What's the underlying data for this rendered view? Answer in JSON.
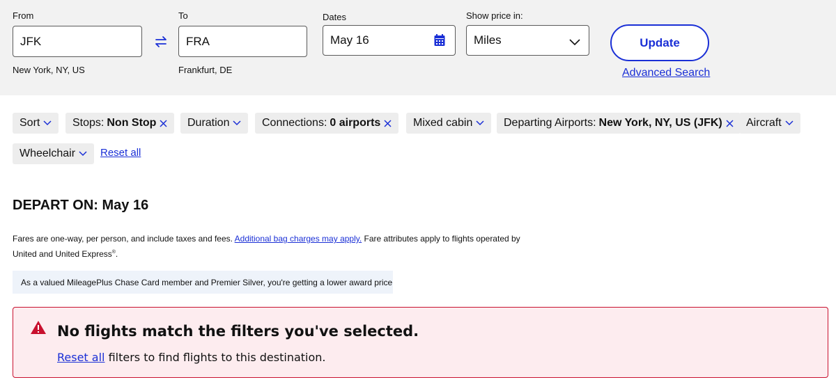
{
  "search": {
    "from_label": "From",
    "from_value": "JFK",
    "from_city": "New York, NY, US",
    "to_label": "To",
    "to_value": "FRA",
    "to_city": "Frankfurt, DE",
    "dates_label": "Dates",
    "dates_value": "May 16",
    "price_label": "Show price in:",
    "price_value": "Miles",
    "update_label": "Update",
    "advanced_label": "Advanced Search"
  },
  "filters": {
    "sort": "Sort",
    "stops_prefix": "Stops:",
    "stops_value": "Non Stop",
    "duration": "Duration",
    "connections_prefix": "Connections:",
    "connections_value": "0 airports",
    "mixed_cabin": "Mixed cabin",
    "departing_prefix": "Departing Airports:",
    "departing_value": "New York, NY, US (JFK)",
    "aircraft": "Aircraft",
    "wheelchair": "Wheelchair",
    "reset_all": "Reset all"
  },
  "main": {
    "depart_title": "DEPART ON: May 16",
    "fares_text_1": "Fares are one-way, per person, and include taxes and fees.",
    "fares_link": "Additional bag charges may apply.",
    "fares_text_2": "Fare attributes apply to flights operated by United and United Express",
    "fares_reg": "®",
    "fares_end": ".",
    "member_text": "As a valued MileagePlus Chase Card member and Premier Silver, you're getting a lower award price"
  },
  "alert": {
    "title": "No flights match the filters you've selected.",
    "link": "Reset all",
    "text": "filters to find flights to this destination."
  },
  "colors": {
    "accent": "#1a2fd6",
    "alert_border": "#c8102e",
    "alert_bg": "#fdecef",
    "panel_bg": "#f2f2f2",
    "chip_bg": "#ededed"
  }
}
